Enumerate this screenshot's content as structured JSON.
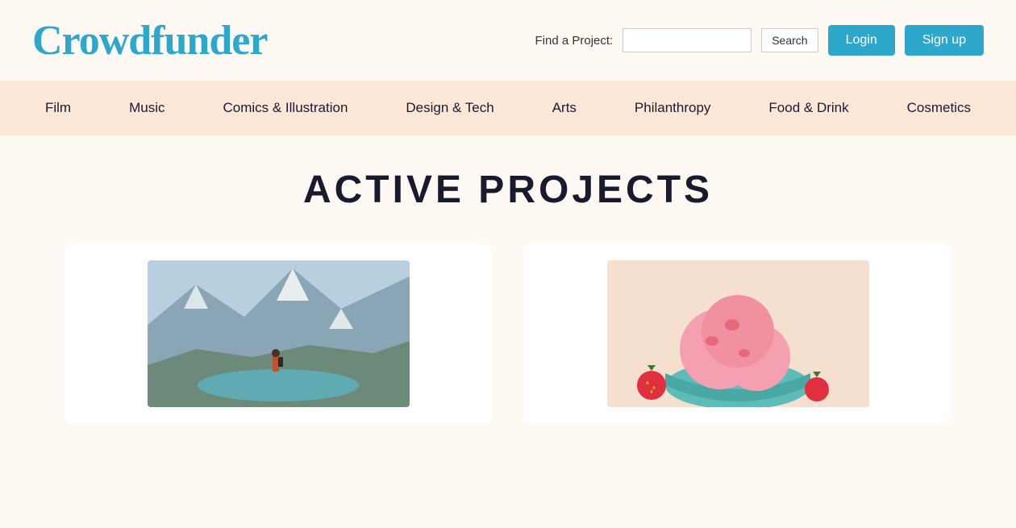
{
  "header": {
    "logo": "Crowdfunder",
    "find_label": "Find a Project:",
    "search_placeholder": "",
    "search_btn": "Search",
    "login_btn": "Login",
    "signup_btn": "Sign up"
  },
  "nav": {
    "items": [
      {
        "label": "Film"
      },
      {
        "label": "Music"
      },
      {
        "label": "Comics & Illustration"
      },
      {
        "label": "Design & Tech"
      },
      {
        "label": "Arts"
      },
      {
        "label": "Philanthropy"
      },
      {
        "label": "Food & Drink"
      },
      {
        "label": "Cosmetics"
      }
    ]
  },
  "main": {
    "title": "ACTIVE PROJECTS"
  },
  "colors": {
    "brand": "#2da8cc",
    "nav_bg": "#fde8d8",
    "page_bg": "#fff9f4",
    "text_dark": "#1a1a2e"
  }
}
